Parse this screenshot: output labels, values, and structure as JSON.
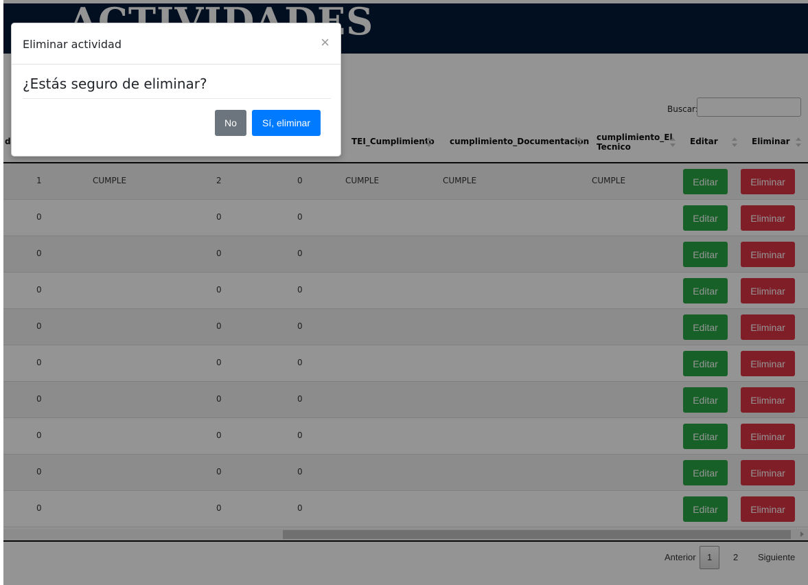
{
  "header": {
    "title": "ACTIVIDADES"
  },
  "search": {
    "label": "Buscar:",
    "value": ""
  },
  "table": {
    "columns": [
      "TEI_Cumplimiento",
      "cumplimiento_Documentacion",
      "cumplimiento_El Tecnico",
      "Editar",
      "Eliminar"
    ],
    "partial_first_col": "di",
    "rows": [
      {
        "c1": "1",
        "c2": "CUMPLE",
        "c3": "2",
        "c4": "0",
        "c5": "CUMPLE",
        "c6": "CUMPLE",
        "c7": "CUMPLE"
      },
      {
        "c1": "0",
        "c2": "",
        "c3": "0",
        "c4": "0",
        "c5": "",
        "c6": "",
        "c7": ""
      },
      {
        "c1": "0",
        "c2": "",
        "c3": "0",
        "c4": "0",
        "c5": "",
        "c6": "",
        "c7": ""
      },
      {
        "c1": "0",
        "c2": "",
        "c3": "0",
        "c4": "0",
        "c5": "",
        "c6": "",
        "c7": ""
      },
      {
        "c1": "0",
        "c2": "",
        "c3": "0",
        "c4": "0",
        "c5": "",
        "c6": "",
        "c7": ""
      },
      {
        "c1": "0",
        "c2": "",
        "c3": "0",
        "c4": "0",
        "c5": "",
        "c6": "",
        "c7": ""
      },
      {
        "c1": "0",
        "c2": "",
        "c3": "0",
        "c4": "0",
        "c5": "",
        "c6": "",
        "c7": ""
      },
      {
        "c1": "0",
        "c2": "",
        "c3": "0",
        "c4": "0",
        "c5": "",
        "c6": "",
        "c7": ""
      },
      {
        "c1": "0",
        "c2": "",
        "c3": "0",
        "c4": "0",
        "c5": "",
        "c6": "",
        "c7": ""
      },
      {
        "c1": "0",
        "c2": "",
        "c3": "0",
        "c4": "0",
        "c5": "",
        "c6": "",
        "c7": ""
      }
    ],
    "edit_label": "Editar",
    "delete_label": "Eliminar"
  },
  "pagination": {
    "prev": "Anterior",
    "pages": [
      "1",
      "2"
    ],
    "current": "1",
    "next": "Siguiente"
  },
  "modal": {
    "title": "Eliminar actividad",
    "close": "×",
    "question": "¿Estás seguro de eliminar?",
    "no_label": "No",
    "yes_label": "Sí, eliminar"
  },
  "colors": {
    "header_bg": "#051b3a",
    "edit": "#28a745",
    "delete": "#dc3545",
    "primary": "#007bff",
    "secondary": "#6c757d"
  },
  "icons": {
    "close": "close-icon",
    "sort": "sort-icon",
    "scroll_right": "chevron-right-icon"
  }
}
